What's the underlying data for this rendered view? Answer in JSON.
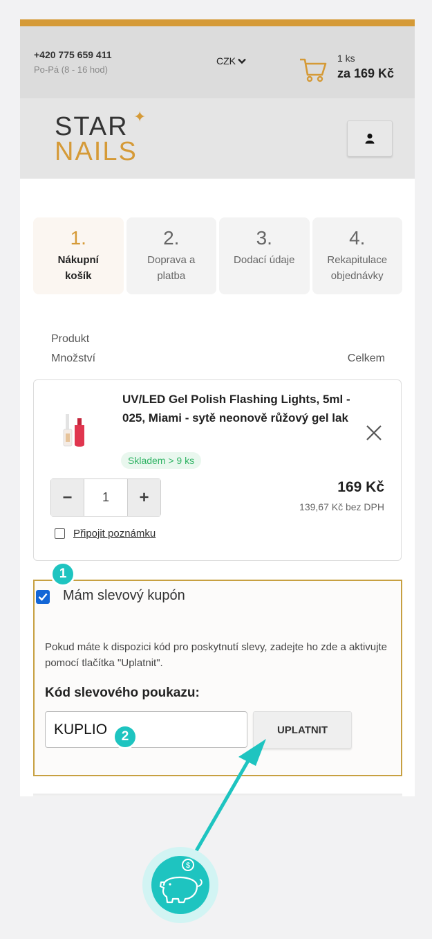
{
  "topbar": {
    "phone": "+420 775 659 411",
    "hours": "Po-Pá (8 - 16 hod)",
    "currency": "CZK",
    "cart_qty": "1 ks",
    "cart_total": "za 169 Kč"
  },
  "logo": {
    "line1": "STAR",
    "line2": "NAILS"
  },
  "steps": [
    {
      "num": "1.",
      "line1": "Nákupní",
      "line2": "košík"
    },
    {
      "num": "2.",
      "line1": "Doprava a",
      "line2": "platba"
    },
    {
      "num": "3.",
      "line1": "Dodací údaje",
      "line2": ""
    },
    {
      "num": "4.",
      "line1": "Rekapitulace",
      "line2": "objednávky"
    }
  ],
  "columns": {
    "product": "Produkt",
    "quantity": "Množství",
    "total": "Celkem"
  },
  "item": {
    "name": "UV/LED Gel Polish Flashing Lights, 5ml - 025, Miami - sytě neonově růžový gel lak",
    "stock": "Skladem > 9 ks",
    "minus": "−",
    "plus": "+",
    "quantity": "1",
    "price": "169 Kč",
    "price_net": "139,67 Kč bez DPH",
    "note_link": "Připojit poznámku"
  },
  "coupon": {
    "label": "Mám slevový kupón",
    "checked": true,
    "description": "Pokud máte k dispozici kód pro poskytnutí slevy, zadejte ho zde a aktivujte pomocí tlačítka \"Uplatnit\".",
    "code_label": "Kód slevového poukazu:",
    "code_value": "KUPLIO",
    "apply_label": "UPLATNIT"
  },
  "annotations": {
    "badge1": "1",
    "badge2": "2"
  },
  "colors": {
    "accent": "#d59a37",
    "teal": "#1ec4c0",
    "checkbox": "#1366d6",
    "stock_green": "#2fb364"
  },
  "icons": [
    "chevron-down-icon",
    "cart-icon",
    "user-icon",
    "close-icon",
    "checkmark-icon",
    "piggy-bank-icon",
    "arrow-icon"
  ]
}
